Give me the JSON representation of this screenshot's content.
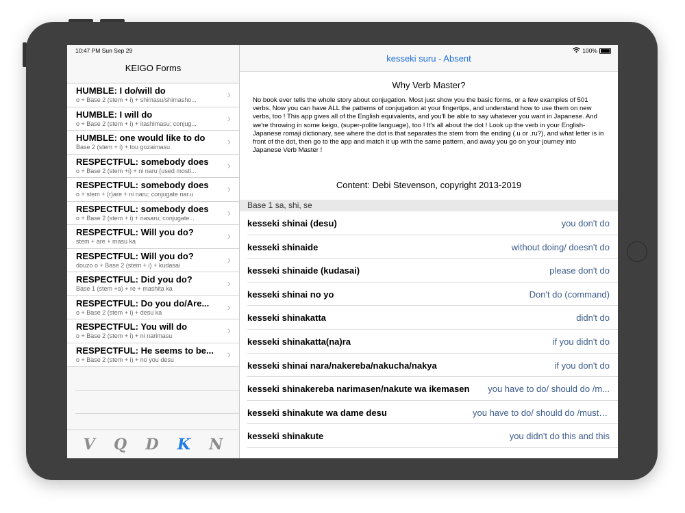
{
  "status": {
    "time": "10:47 PM  Sun Sep 29",
    "battery": "100%"
  },
  "sidebar": {
    "title": "KEIGO Forms",
    "items": [
      {
        "title": "HUMBLE: I do/will do",
        "subtitle": "o + Base 2 (stem + i) + shimasu/shimasho..."
      },
      {
        "title": "HUMBLE: I will do",
        "subtitle": "o + Base 2 (stem + i) + itashimasu; conjug..."
      },
      {
        "title": "HUMBLE: one would like to do",
        "subtitle": "Base 2 (stem + i) + tou gozaimasu"
      },
      {
        "title": "RESPECTFUL: somebody does",
        "subtitle": "o + Base 2 (stem +i) + ni naru  (used mostl..."
      },
      {
        "title": "RESPECTFUL: somebody does",
        "subtitle": "o + stem + (r)are + ni naru; conjugate nar.u"
      },
      {
        "title": "RESPECTFUL: somebody does",
        "subtitle": "o + Base 2 (stem + i) + nasaru; conjugate..."
      },
      {
        "title": "RESPECTFUL: Will you do?",
        "subtitle": "stem + are +  masu ka"
      },
      {
        "title": "RESPECTFUL: Will you do?",
        "subtitle": "douzo o + Base 2 (stem + i) + kudasai"
      },
      {
        "title": "RESPECTFUL: Did you do?",
        "subtitle": "Base 1 (stem +a) + re + mashita ka"
      },
      {
        "title": "RESPECTFUL: Do you do/Are...",
        "subtitle": "o + Base 2 (stem + i) + desu ka"
      },
      {
        "title": "RESPECTFUL: You will do",
        "subtitle": "o + Base 2 (stem + i) + ni narimasu"
      },
      {
        "title": "RESPECTFUL: He seems to be...",
        "subtitle": "o + Base 2 (stem + i) + no you desu"
      }
    ],
    "tabs": [
      "V",
      "Q",
      "D",
      "K",
      "N"
    ]
  },
  "detail": {
    "nav_title": "kesseki suru - Absent",
    "intro_heading": "Why Verb Master?",
    "intro_body": "No book ever tells the whole story about conjugation. Most just show you the basic forms, or a few examples of 501 verbs. Now you can have ALL the patterns of conjugation at your fingertips, and understand how to use them on new verbs, too ! This app gives all of the English equivalents, and you'll be able to say whatever you want in Japanese. And we're throwing in some keigo, (super-polite language), too ! It's all about the dot ! Look up the verb in your English-Japanese romaji dictionary, see where the dot is that separates the stem from the ending (.u or .ru?), and what letter is in front of the dot, then go to the app and match it up with the same pattern, and away you go on your journey into  Japanese Verb Master !",
    "content_line": "Content: Debi Stevenson, copyright 2013-2019",
    "section_header": "Base 1  sa, shi, se",
    "rows": [
      {
        "jp": "kesseki shinai (desu)",
        "en": "you don't do"
      },
      {
        "jp": "kesseki shinaide",
        "en": "without doing/ doesn't do"
      },
      {
        "jp": "kesseki shinaide (kudasai)",
        "en": "please don't do"
      },
      {
        "jp": "kesseki shinai no yo",
        "en": "Don't do  (command)"
      },
      {
        "jp": "kesseki shinakatta",
        "en": "didn't do"
      },
      {
        "jp": "kesseki shinakatta(na)ra",
        "en": "if you didn't do"
      },
      {
        "jp": "kesseki shinai nara/nakereba/nakucha/nakya",
        "en": "if you don't do"
      },
      {
        "jp": "kesseki shinakereba narimasen/nakute wa ikemasen",
        "en": "you have to do/ should do /m..."
      },
      {
        "jp": "kesseki shinakute wa dame desu",
        "en": "you have to do/ should do /must do"
      },
      {
        "jp": "kesseki shinakute",
        "en": "you didn't do this and this"
      }
    ]
  },
  "colors": {
    "accent": "#1e7ae8",
    "nav_title": "#1a6fe0",
    "device": "#3f3f3f"
  }
}
